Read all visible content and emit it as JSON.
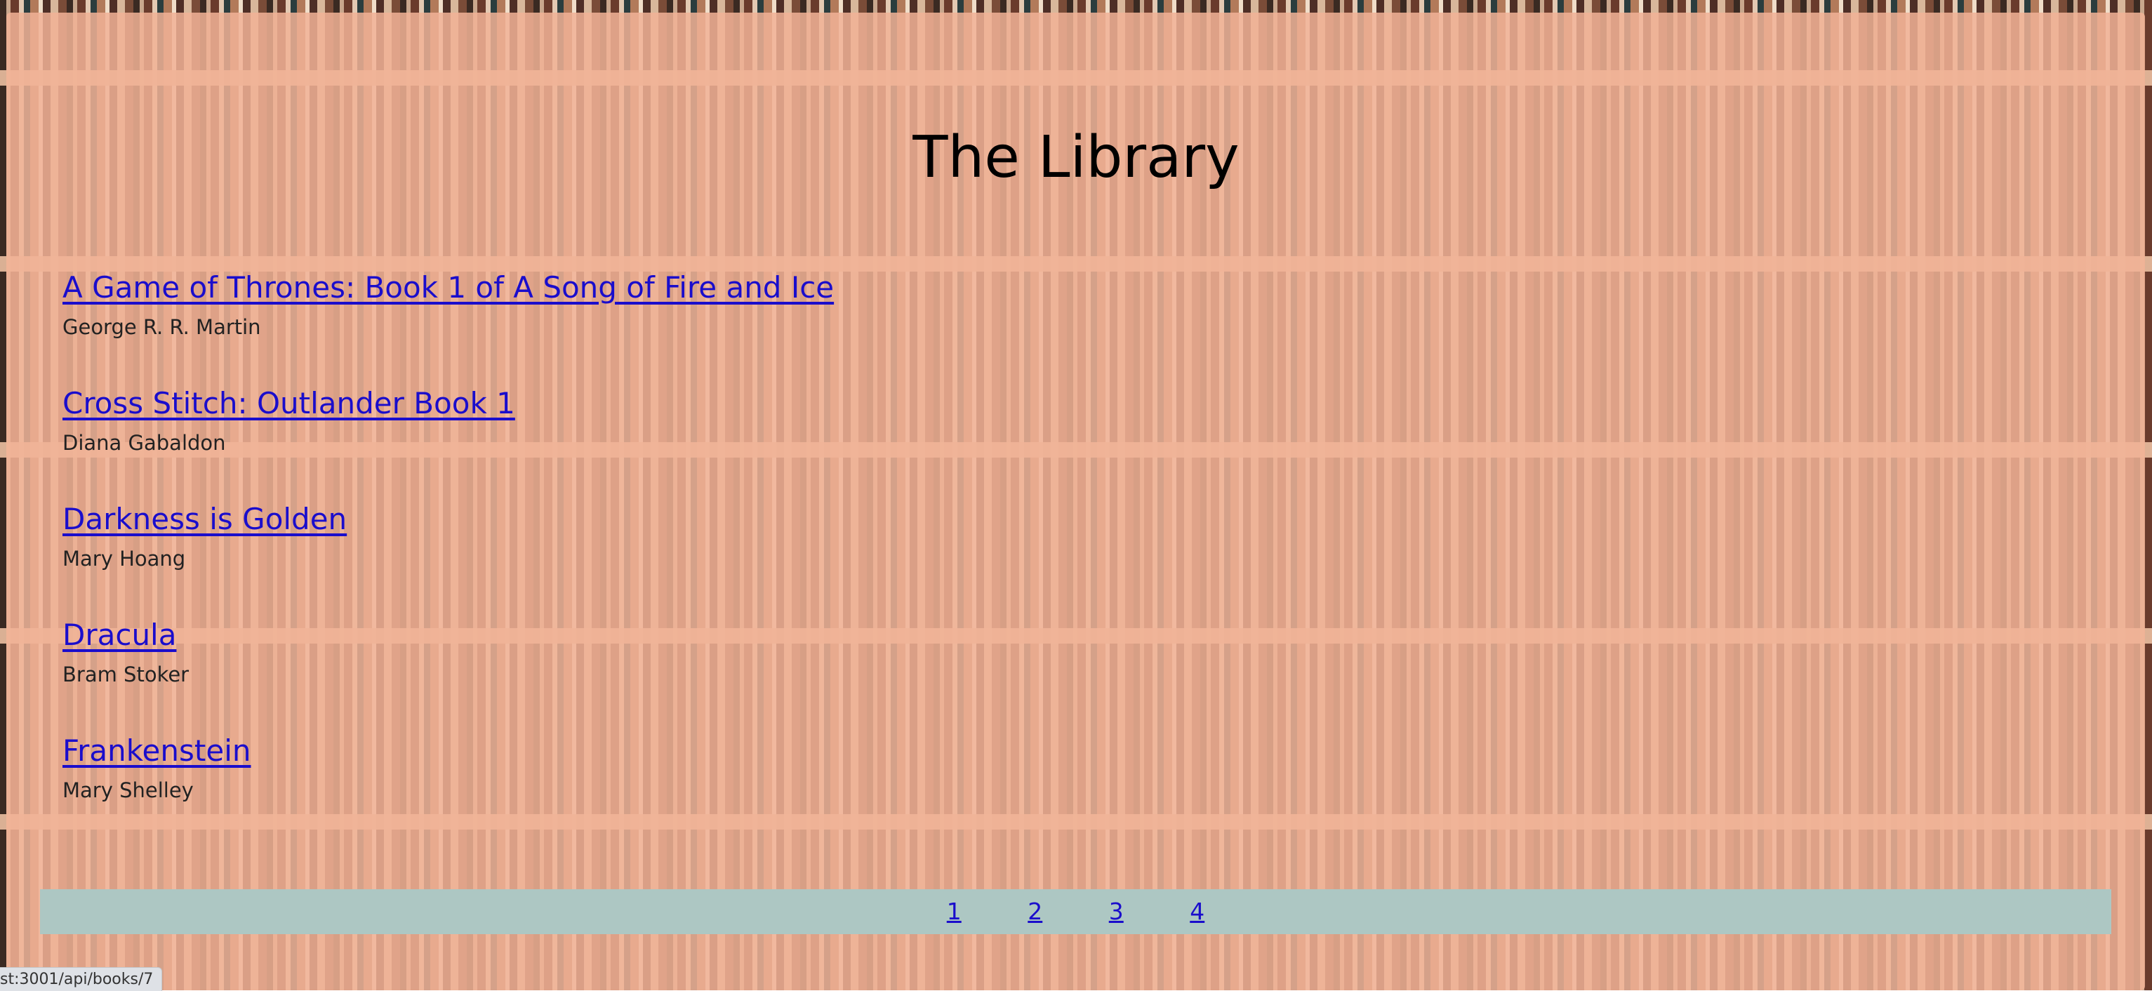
{
  "page": {
    "title": "The Library"
  },
  "books": [
    {
      "title": "A Game of Thrones: Book 1 of A Song of Fire and Ice",
      "author": "George R. R. Martin"
    },
    {
      "title": "Cross Stitch: Outlander Book 1",
      "author": "Diana Gabaldon"
    },
    {
      "title": "Darkness is Golden",
      "author": "Mary Hoang"
    },
    {
      "title": "Dracula",
      "author": "Bram Stoker"
    },
    {
      "title": "Frankenstein",
      "author": "Mary Shelley"
    }
  ],
  "pagination": {
    "pages": [
      "1",
      "2",
      "3",
      "4"
    ]
  },
  "status_bar": {
    "url": "st:3001/api/books/7"
  },
  "colors": {
    "panel": "#f1b296",
    "link": "#1a0dcc",
    "pagination_bg": "#adc7c3"
  }
}
